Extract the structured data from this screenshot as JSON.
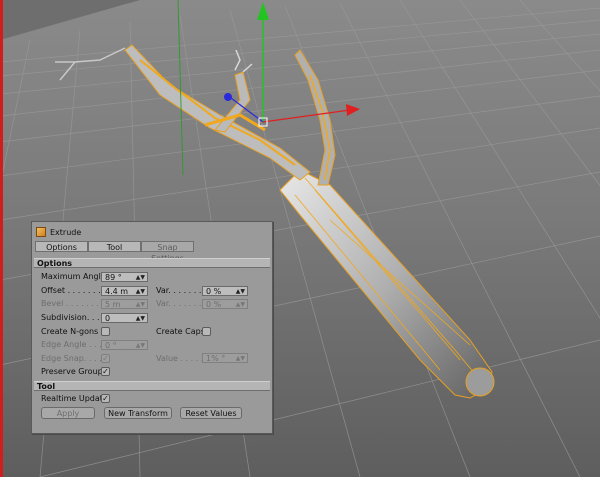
{
  "attribute_manager": {
    "title": "Extrude",
    "tabs": [
      {
        "label": "Options"
      },
      {
        "label": "Tool"
      },
      {
        "label": "Snap Settings"
      }
    ],
    "options_section": {
      "header": "Options",
      "maximum_angle": {
        "label": "Maximum Angle",
        "value": "89 °"
      },
      "offset": {
        "label": "Offset . . . . . . . .",
        "value": "4.4 m"
      },
      "offset_var": {
        "label": "Var. . . . . . .",
        "value": "0 %"
      },
      "bevel": {
        "label": "Bevel . . . . . . . .",
        "value": "5 m"
      },
      "bevel_var": {
        "label": "Var. . . . . . .",
        "value": "0 %"
      },
      "subdivision": {
        "label": "Subdivision. . . .",
        "value": "0"
      },
      "create_ngons": {
        "label": "Create N-gons . .",
        "checked": false
      },
      "create_caps": {
        "label": "Create Caps",
        "checked": false
      },
      "edge_angle": {
        "label": "Edge Angle . . . .",
        "value": "0 °"
      },
      "edge_snap": {
        "label": "Edge Snap. . . . .",
        "checked": true
      },
      "edge_snap_value": {
        "label": "Value . . . . . .",
        "value": "1% °"
      },
      "preserve_groups": {
        "label": "Preserve Groups",
        "checked": true
      }
    },
    "tool_section": {
      "header": "Tool",
      "realtime_update": {
        "label": "Realtime Update",
        "checked": true
      },
      "apply_label": "Apply",
      "new_transform_label": "New Transform",
      "reset_values_label": "Reset Values"
    }
  },
  "icons": {
    "panel": "extrude-cube-icon",
    "check": "checkmark-icon"
  }
}
